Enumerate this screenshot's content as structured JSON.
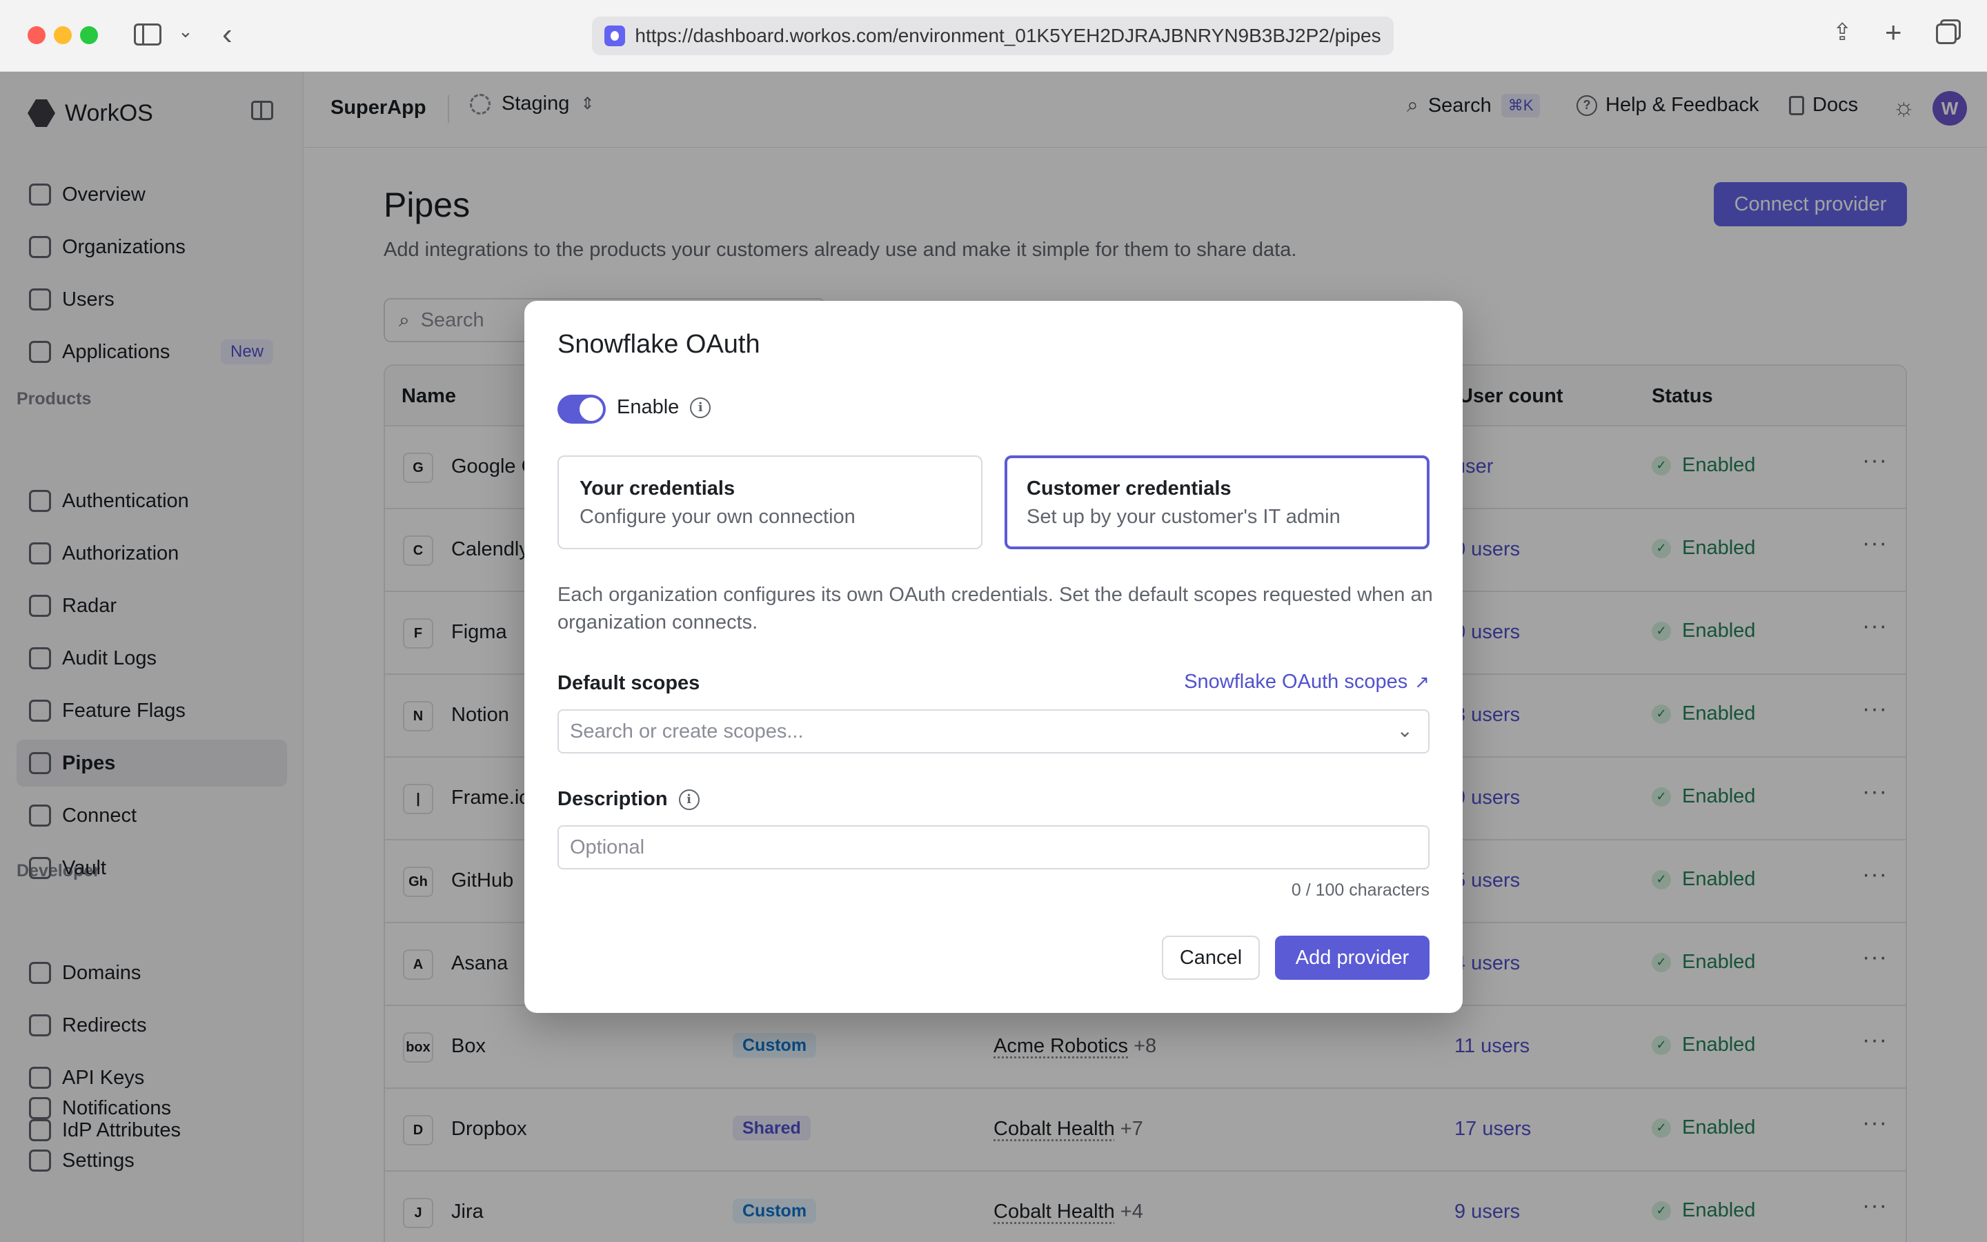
{
  "browser": {
    "url": "https://dashboard.workos.com/environment_01K5YEH2DJRAJBNRYN9B3BJ2P2/pipes"
  },
  "sidebar": {
    "brand": "WorkOS",
    "items_top": [
      {
        "label": "Overview",
        "icon": "grid-icon"
      },
      {
        "label": "Organizations",
        "icon": "building-icon"
      },
      {
        "label": "Users",
        "icon": "user-icon"
      },
      {
        "label": "Applications",
        "icon": "layers-icon",
        "badge": "New"
      }
    ],
    "products_label": "Products",
    "products": [
      {
        "label": "Authentication",
        "icon": "id-card-icon"
      },
      {
        "label": "Authorization",
        "icon": "shield-icon"
      },
      {
        "label": "Radar",
        "icon": "radar-icon"
      },
      {
        "label": "Audit Logs",
        "icon": "log-icon"
      },
      {
        "label": "Feature Flags",
        "icon": "toggle-icon"
      },
      {
        "label": "Pipes",
        "icon": "pipe-icon",
        "active": true
      },
      {
        "label": "Connect",
        "icon": "connect-icon"
      },
      {
        "label": "Vault",
        "icon": "vault-icon"
      }
    ],
    "developer_label": "Developer",
    "developer": [
      {
        "label": "Domains",
        "icon": "globe-icon"
      },
      {
        "label": "Redirects",
        "icon": "link-icon"
      },
      {
        "label": "API Keys",
        "icon": "key-icon"
      },
      {
        "label": "IdP Attributes",
        "icon": "attributes-icon"
      }
    ],
    "bottom": [
      {
        "label": "Notifications",
        "icon": "bell-icon"
      },
      {
        "label": "Settings",
        "icon": "gear-icon"
      }
    ]
  },
  "topbar": {
    "app_name": "SuperApp",
    "environment": "Staging",
    "search_label": "Search",
    "search_shortcut": "⌘K",
    "help_label": "Help & Feedback",
    "docs_label": "Docs",
    "avatar_initial": "W"
  },
  "page": {
    "title": "Pipes",
    "subtitle": "Add integrations to the products your customers already use and make it simple for them to share data.",
    "connect_button": "Connect provider",
    "search_placeholder": "Search"
  },
  "table": {
    "headers": {
      "name": "Name",
      "user_count": "User count",
      "status": "Status"
    },
    "rows": [
      {
        "name": "Google C",
        "icon": "G",
        "type": "",
        "org": "",
        "org_more": "",
        "users": "user",
        "status": "Enabled"
      },
      {
        "name": "Calendly",
        "icon": "C",
        "type": "",
        "org": "",
        "org_more": "",
        "users": "0 users",
        "status": "Enabled"
      },
      {
        "name": "Figma",
        "icon": "F",
        "type": "",
        "org": "",
        "org_more": "",
        "users": "0 users",
        "status": "Enabled"
      },
      {
        "name": "Notion",
        "icon": "N",
        "type": "",
        "org": "",
        "org_more": "",
        "users": "3 users",
        "status": "Enabled"
      },
      {
        "name": "Frame.ic",
        "icon": "|",
        "type": "",
        "org": "",
        "org_more": "",
        "users": "9 users",
        "status": "Enabled"
      },
      {
        "name": "GitHub",
        "icon": "Gh",
        "type": "",
        "org": "",
        "org_more": "",
        "users": "5 users",
        "status": "Enabled"
      },
      {
        "name": "Asana",
        "icon": "A",
        "type": "",
        "org": "",
        "org_more": "",
        "users": "4 users",
        "status": "Enabled"
      },
      {
        "name": "Box",
        "icon": "box",
        "type": "Custom",
        "org": "Acme Robotics",
        "org_more": "+8",
        "users": "11 users",
        "status": "Enabled"
      },
      {
        "name": "Dropbox",
        "icon": "D",
        "type": "Shared",
        "org": "Cobalt Health",
        "org_more": "+7",
        "users": "17 users",
        "status": "Enabled"
      },
      {
        "name": "Jira",
        "icon": "J",
        "type": "Custom",
        "org": "Cobalt Health",
        "org_more": "+4",
        "users": "9 users",
        "status": "Enabled"
      }
    ]
  },
  "modal": {
    "title": "Snowflake OAuth",
    "enable_label": "Enable",
    "enabled": true,
    "option_own_title": "Your credentials",
    "option_own_desc": "Configure your own connection",
    "option_customer_title": "Customer credentials",
    "option_customer_desc": "Set up by your customer's IT admin",
    "selected_option": "customer",
    "description_text": "Each organization configures its own OAuth credentials. Set the default scopes requested when an organization connects.",
    "scopes_label": "Default scopes",
    "scopes_link": "Snowflake OAuth scopes",
    "scopes_placeholder": "Search or create scopes...",
    "description_label": "Description",
    "description_placeholder": "Optional",
    "char_count": "0 / 100 characters",
    "cancel_label": "Cancel",
    "add_label": "Add provider"
  },
  "colors": {
    "accent": "#5b5bd6",
    "success": "#218358"
  }
}
